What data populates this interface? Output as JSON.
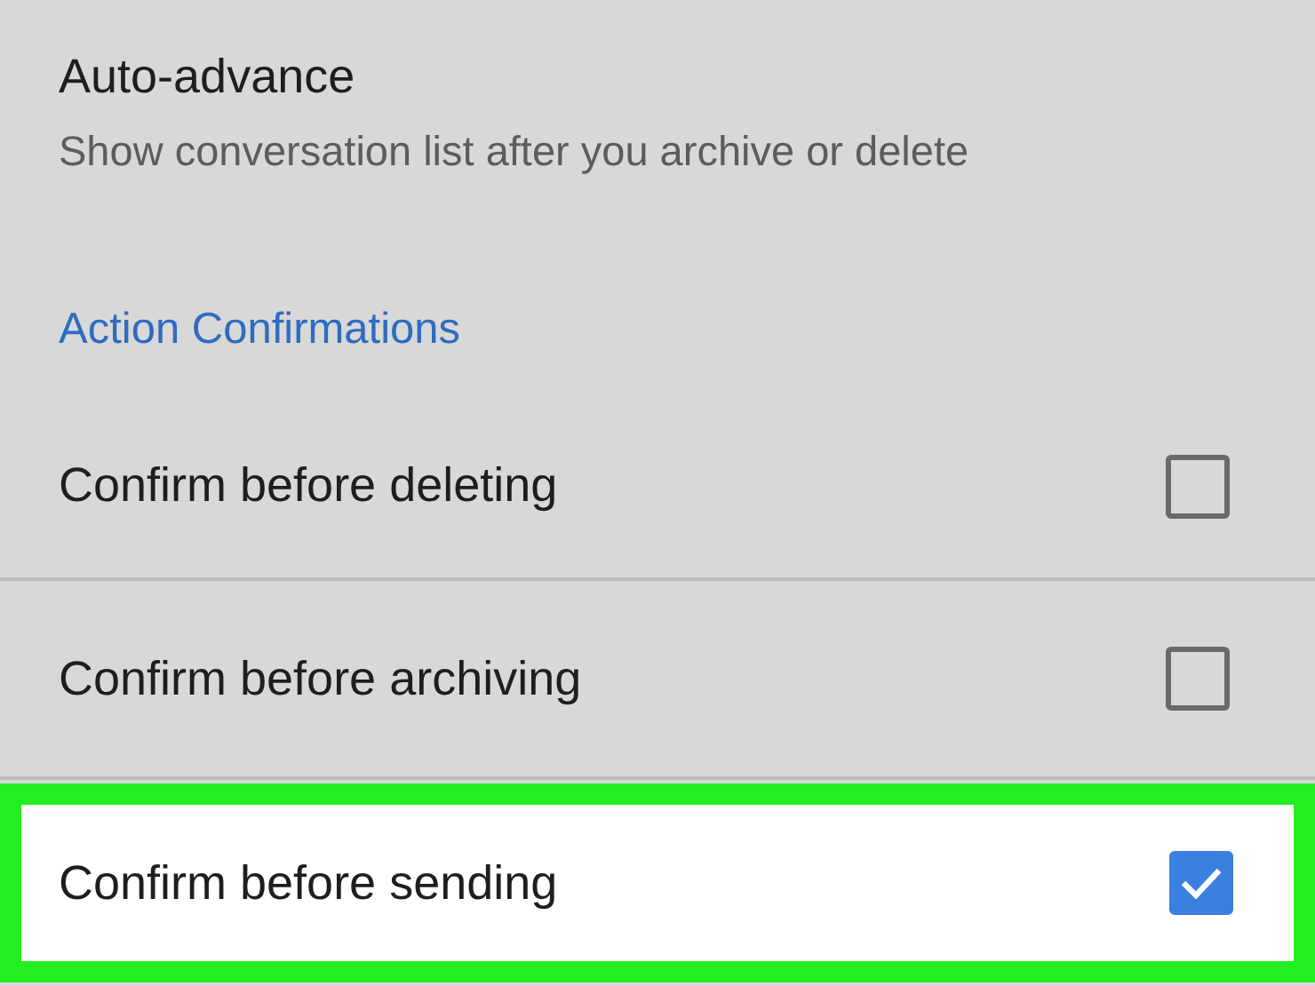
{
  "setting": {
    "title": "Auto-advance",
    "subtitle": "Show conversation list after you archive or delete"
  },
  "section": {
    "title": "Action Confirmations"
  },
  "options": [
    {
      "label": "Confirm before deleting",
      "checked": false,
      "highlighted": false
    },
    {
      "label": "Confirm before archiving",
      "checked": false,
      "highlighted": false
    },
    {
      "label": "Confirm before sending",
      "checked": true,
      "highlighted": true
    }
  ]
}
